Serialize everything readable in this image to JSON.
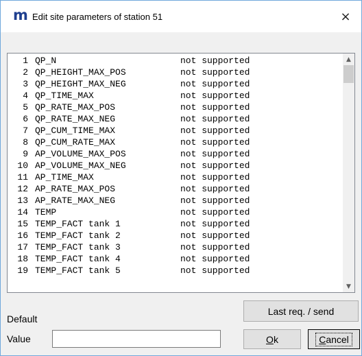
{
  "window": {
    "title": "Edit site parameters of station 51",
    "app_icon_glyph": "m",
    "close_glyph": "×"
  },
  "parameters": [
    {
      "num": "1",
      "name": "QP_N",
      "status": "not supported"
    },
    {
      "num": "2",
      "name": "QP_HEIGHT_MAX_POS",
      "status": "not supported"
    },
    {
      "num": "3",
      "name": "QP_HEIGHT_MAX_NEG",
      "status": "not supported"
    },
    {
      "num": "4",
      "name": "QP_TIME_MAX",
      "status": "not supported"
    },
    {
      "num": "5",
      "name": "QP_RATE_MAX_POS",
      "status": "not supported"
    },
    {
      "num": "6",
      "name": "QP_RATE_MAX_NEG",
      "status": "not supported"
    },
    {
      "num": "7",
      "name": "QP_CUM_TIME_MAX",
      "status": "not supported"
    },
    {
      "num": "8",
      "name": "QP_CUM_RATE_MAX",
      "status": "not supported"
    },
    {
      "num": "9",
      "name": "AP_VOLUME_MAX_POS",
      "status": "not supported"
    },
    {
      "num": "10",
      "name": "AP_VOLUME_MAX_NEG",
      "status": "not supported"
    },
    {
      "num": "11",
      "name": "AP_TIME_MAX",
      "status": "not supported"
    },
    {
      "num": "12",
      "name": "AP_RATE_MAX_POS",
      "status": "not supported"
    },
    {
      "num": "13",
      "name": "AP_RATE_MAX_NEG",
      "status": "not supported"
    },
    {
      "num": "14",
      "name": "TEMP",
      "status": "not supported"
    },
    {
      "num": "15",
      "name": "TEMP_FACT tank 1",
      "status": "not supported"
    },
    {
      "num": "16",
      "name": "TEMP_FACT tank 2",
      "status": "not supported"
    },
    {
      "num": "17",
      "name": "TEMP_FACT tank 3",
      "status": "not supported"
    },
    {
      "num": "18",
      "name": "TEMP_FACT tank 4",
      "status": "not supported"
    },
    {
      "num": "19",
      "name": "TEMP_FACT tank 5",
      "status": "not supported"
    }
  ],
  "scrollbar": {
    "up_glyph": "▲",
    "down_glyph": "▼"
  },
  "footer": {
    "last_req_label": "Last req. / send",
    "default_label": "Default",
    "value_label": "Value",
    "value_input": "",
    "ok_accel": "O",
    "ok_rest": "k",
    "cancel_accel": "C",
    "cancel_rest": "ancel"
  },
  "colors": {
    "title_icon": "#1f3f8f",
    "window_border": "#6fa8dc",
    "dialog_bg": "#f0f0f0"
  }
}
